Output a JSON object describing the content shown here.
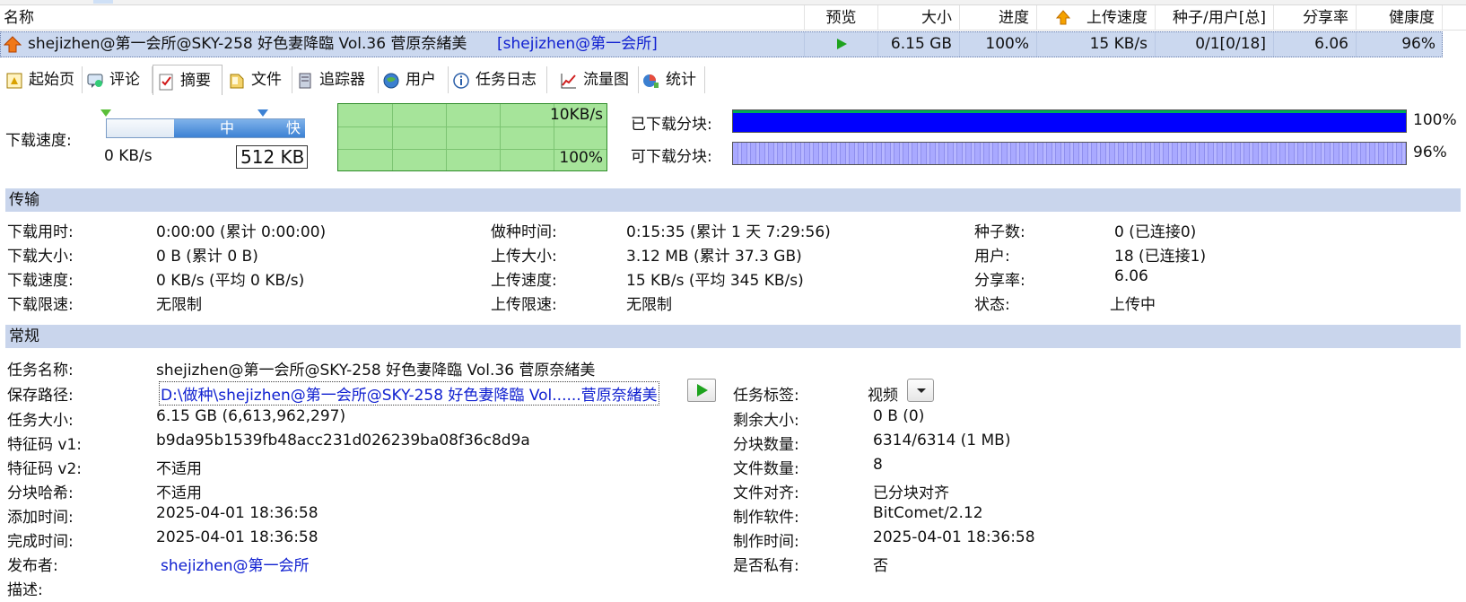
{
  "list": {
    "headers": {
      "name": "名称",
      "preview": "预览",
      "size": "大小",
      "progress": "进度",
      "upload_speed": "上传速度",
      "seeds_peers": "种子/用户[总]",
      "ratio": "分享率",
      "health": "健康度"
    },
    "row": {
      "name": "shejizhen@第一会所@SKY-258 好色妻降臨 Vol.36  菅原奈緒美",
      "name_tag": "[shejizhen@第一会所]",
      "size": "6.15 GB",
      "progress": "100%",
      "upload_speed": "15 KB/s",
      "seeds_peers": "0/1[0/18]",
      "ratio": "6.06",
      "health": "96%"
    }
  },
  "tabs": [
    {
      "label": "起始页",
      "icon": "home-page-icon"
    },
    {
      "label": "评论",
      "icon": "comment-icon"
    },
    {
      "label": "摘要",
      "icon": "summary-icon"
    },
    {
      "label": "文件",
      "icon": "file-icon"
    },
    {
      "label": "追踪器",
      "icon": "tracker-icon"
    },
    {
      "label": "用户",
      "icon": "users-icon"
    },
    {
      "label": "任务日志",
      "icon": "info-icon"
    },
    {
      "label": "流量图",
      "icon": "traffic-chart-icon"
    },
    {
      "label": "统计",
      "icon": "statistics-icon"
    }
  ],
  "active_tab": "摘要",
  "summary": {
    "download_speed_label": "下载速度:",
    "current_speed": "0 KB/s",
    "speed_mid": "中",
    "speed_fast": "快",
    "limit_value": "512 KB",
    "graph_max": "10KB/s",
    "graph_pct": "100%",
    "downloaded_label": "已下载分块:",
    "downloaded_pct": "100%",
    "downloaded_fraction": 1.0,
    "available_label": "可下载分块:",
    "available_pct": "96%",
    "available_fraction": 0.96
  },
  "transfer": {
    "title": "传输",
    "col1": [
      {
        "k": "下载用时:",
        "v": "0:00:00 (累计 0:00:00)"
      },
      {
        "k": "下载大小:",
        "v": "0 B (累计 0 B)"
      },
      {
        "k": "下载速度:",
        "v": "0 KB/s (平均 0 KB/s)"
      },
      {
        "k": "下载限速:",
        "v": "无限制"
      }
    ],
    "col2": [
      {
        "k": "做种时间:",
        "v": "0:15:35 (累计 1 天 7:29:56)"
      },
      {
        "k": "上传大小:",
        "v": "3.12 MB (累计 37.3 GB)"
      },
      {
        "k": "上传速度:",
        "v": "15 KB/s (平均 345 KB/s)"
      },
      {
        "k": "上传限速:",
        "v": "无限制"
      }
    ],
    "col3": [
      {
        "k": "种子数:",
        "v": "0 (已连接0)"
      },
      {
        "k": "用户:",
        "v": "18 (已连接1)"
      },
      {
        "k": "分享率:",
        "v": "6.06"
      },
      {
        "k": "状态:",
        "v": "上传中"
      }
    ]
  },
  "general": {
    "title": "常规",
    "left": [
      {
        "k": "任务名称:",
        "v": "shejizhen@第一会所@SKY-258 好色妻降臨 Vol.36  菅原奈緒美"
      },
      {
        "k": "保存路径:",
        "v": "D:\\做种\\shejizhen@第一会所@SKY-258 好色妻降臨 Vol......菅原奈緒美"
      },
      {
        "k": "任务大小:",
        "v": "6.15 GB (6,613,962,297)"
      },
      {
        "k": "特征码 v1:",
        "v": "b9da95b1539fb48acc231d026239ba08f36c8d9a"
      },
      {
        "k": "特征码 v2:",
        "v": "不适用"
      },
      {
        "k": "分块哈希:",
        "v": "不适用"
      },
      {
        "k": "添加时间:",
        "v": "2025-04-01 18:36:58"
      },
      {
        "k": "完成时间:",
        "v": "2025-04-01 18:36:58"
      },
      {
        "k": "发布者:",
        "v": "shejizhen@第一会所"
      },
      {
        "k": "描述:",
        "v": ""
      }
    ],
    "right": [
      {
        "k": "任务标签:",
        "v": "视频"
      },
      {
        "k": "剩余大小:",
        "v": "0 B (0)"
      },
      {
        "k": "分块数量:",
        "v": "6314/6314 (1 MB)"
      },
      {
        "k": "文件数量:",
        "v": "8"
      },
      {
        "k": "文件对齐:",
        "v": "已分块对齐"
      },
      {
        "k": "制作软件:",
        "v": "BitComet/2.12"
      },
      {
        "k": "制作时间:",
        "v": "2025-04-01 18:36:58"
      },
      {
        "k": "是否私有:",
        "v": "否"
      }
    ]
  },
  "colors": {
    "selection": "#cbd8ef",
    "section_header": "#c9d5ec",
    "link": "#1020d0",
    "graph_bg": "#a6e49a",
    "downloaded_bar": "#0000ff",
    "available_bar": "#a9a9ff",
    "play_green": "#1ea31e"
  }
}
